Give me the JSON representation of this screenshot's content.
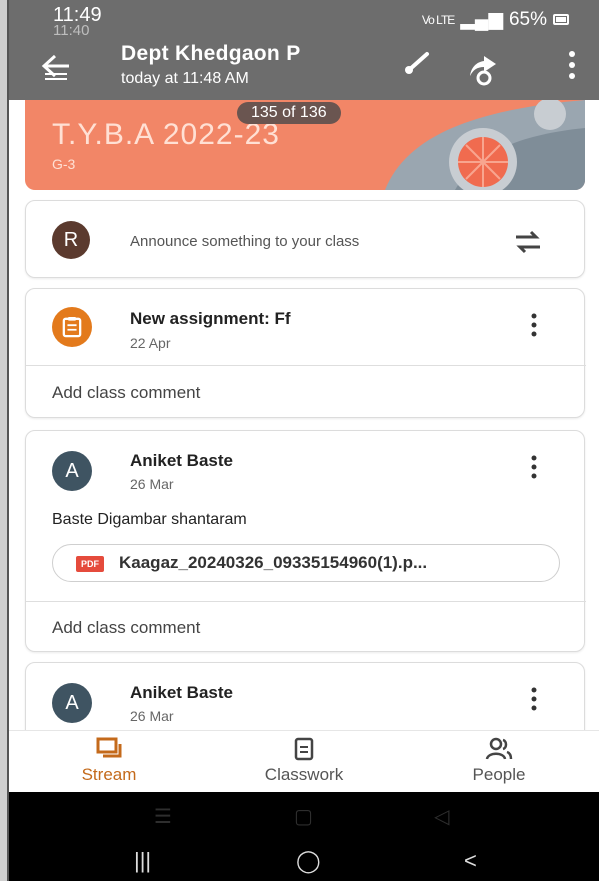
{
  "status_bar": {
    "time": "11:49",
    "ghost_time": "11:40",
    "battery": "65%",
    "network": "Vo LTE"
  },
  "header": {
    "title": "Dept  Khedgaon P",
    "subtitle": "today at 11:48 AM"
  },
  "banner": {
    "title": "T.Y.B.A 2022-23",
    "section": "G-3",
    "counter": "135 of 136",
    "color": "#f28667"
  },
  "announce": {
    "avatar_letter": "R",
    "placeholder": "Announce something to your class",
    "avatar_color": "#5b3a2e"
  },
  "posts": [
    {
      "title": "New assignment: Ff",
      "date": "22 Apr",
      "comment_label": "Add class comment",
      "icon_color": "#e37a1c"
    },
    {
      "avatar_letter": "A",
      "author": "Aniket Baste",
      "date": "26 Mar",
      "body": "Baste Digambar shantaram",
      "attachment_type": "PDF",
      "attachment_name": "Kaagaz_20240326_09335154960(1).p...",
      "comment_label": "Add class comment",
      "avatar_color": "#3f5462"
    },
    {
      "avatar_letter": "A",
      "author": "Aniket Baste",
      "date": "26 Mar",
      "avatar_color": "#3f5462"
    }
  ],
  "bottom_nav": {
    "items": [
      {
        "label": "Stream",
        "icon": "stream-icon",
        "active": true
      },
      {
        "label": "Classwork",
        "icon": "classwork-icon",
        "active": false
      },
      {
        "label": "People",
        "icon": "people-icon",
        "active": false
      }
    ],
    "active_color": "#c46a1b"
  },
  "system_nav": {
    "recents": "|||",
    "home": "◯",
    "back": "<"
  }
}
